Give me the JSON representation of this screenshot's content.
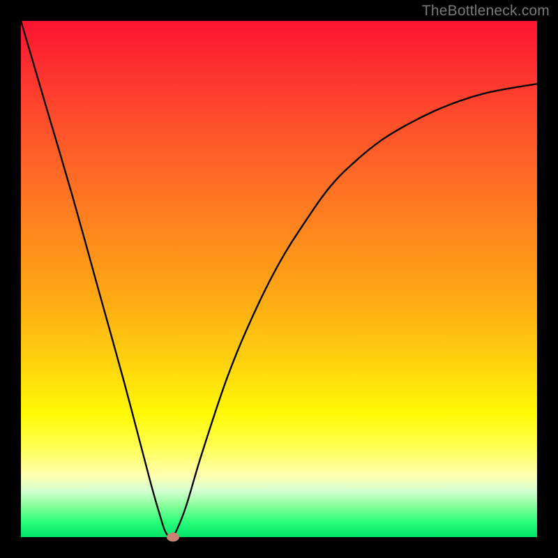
{
  "attribution": "TheBottleneck.com",
  "chart_data": {
    "type": "line",
    "title": "",
    "xlabel": "",
    "ylabel": "",
    "xlim": [
      0,
      1
    ],
    "ylim": [
      0,
      1
    ],
    "series": [
      {
        "name": "curve",
        "x": [
          0.0,
          0.05,
          0.1,
          0.15,
          0.2,
          0.25,
          0.27,
          0.28,
          0.29,
          0.3,
          0.32,
          0.35,
          0.4,
          0.45,
          0.5,
          0.55,
          0.6,
          0.65,
          0.7,
          0.75,
          0.8,
          0.85,
          0.9,
          0.95,
          1.0
        ],
        "y": [
          1.0,
          0.83,
          0.66,
          0.48,
          0.3,
          0.11,
          0.04,
          0.01,
          0.0,
          0.01,
          0.06,
          0.16,
          0.31,
          0.43,
          0.53,
          0.61,
          0.68,
          0.73,
          0.77,
          0.8,
          0.825,
          0.845,
          0.86,
          0.87,
          0.878
        ]
      }
    ],
    "marker": {
      "x": 0.295,
      "y": 0.0
    },
    "background_gradient": {
      "direction": "vertical",
      "stops": [
        {
          "pos": 0.0,
          "color": "#fd1430"
        },
        {
          "pos": 0.3,
          "color": "#ff6a26"
        },
        {
          "pos": 0.66,
          "color": "#ffd20e"
        },
        {
          "pos": 0.82,
          "color": "#ffff4a"
        },
        {
          "pos": 0.94,
          "color": "#86ff9a"
        },
        {
          "pos": 1.0,
          "color": "#00e468"
        }
      ]
    }
  }
}
